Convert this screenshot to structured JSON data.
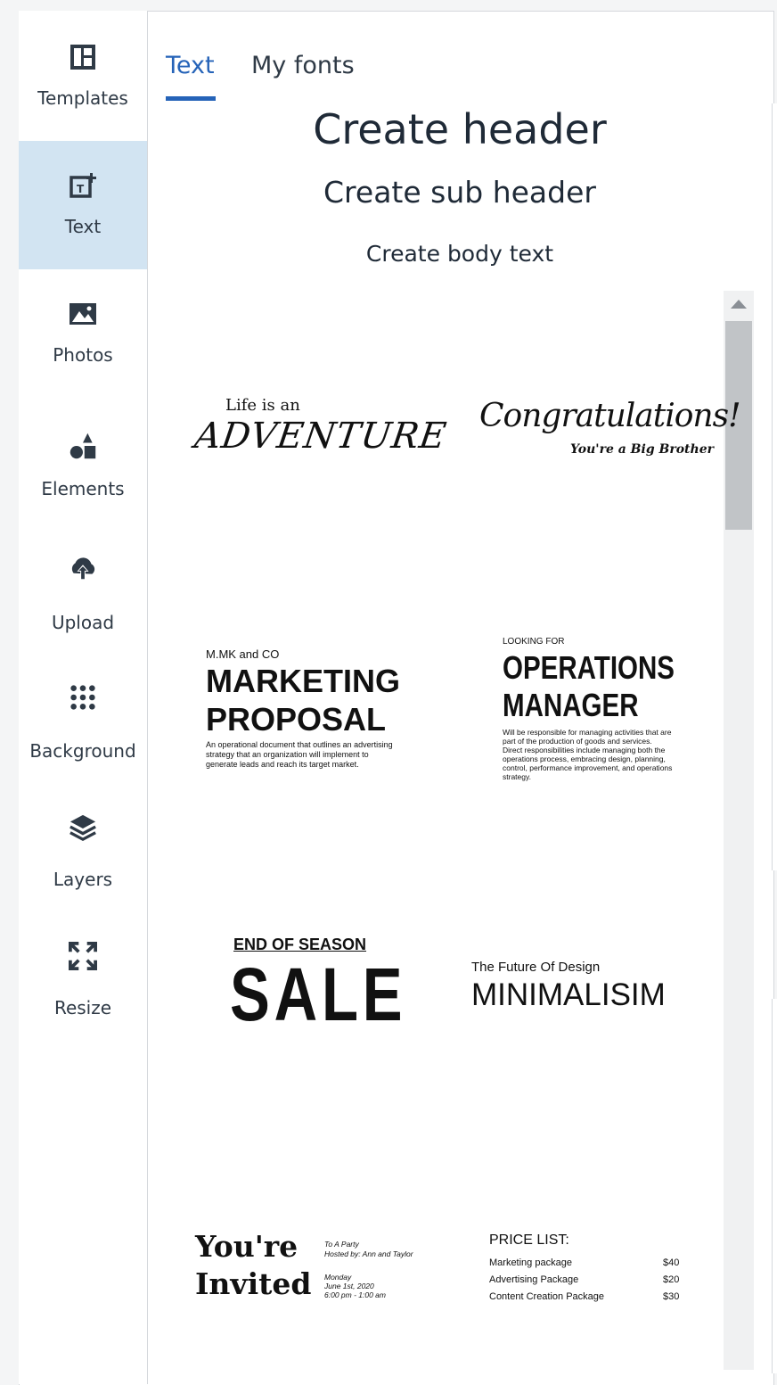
{
  "sidebar": {
    "items": [
      {
        "label": "Templates",
        "icon": "templates-icon"
      },
      {
        "label": "Text",
        "icon": "text-icon",
        "active": true
      },
      {
        "label": "Photos",
        "icon": "photos-icon"
      },
      {
        "label": "Elements",
        "icon": "elements-icon"
      },
      {
        "label": "Upload",
        "icon": "upload-icon"
      },
      {
        "label": "Background",
        "icon": "background-icon"
      },
      {
        "label": "Layers",
        "icon": "layers-icon"
      },
      {
        "label": "Resize",
        "icon": "resize-icon"
      }
    ]
  },
  "tabs": [
    {
      "label": "Text",
      "active": true
    },
    {
      "label": "My fonts",
      "active": false
    }
  ],
  "create": {
    "header": "Create header",
    "subheader": "Create sub header",
    "body": "Create body text"
  },
  "templates": {
    "adventure": {
      "line1": "Life is an",
      "line2": "ADVENTURE"
    },
    "congrats": {
      "line1": "Congratulations!",
      "line2": "You're a Big Brother"
    },
    "marketing": {
      "line1": "M.MK and CO",
      "line2": "MARKETING",
      "line3": "PROPOSAL",
      "body1": "An operational document that outlines an advertising",
      "body2": "strategy that an organization will implement to",
      "body3": "generate leads and reach its target market."
    },
    "operations": {
      "line1": "LOOKING FOR",
      "line2": "OPERATIONS",
      "line3": "MANAGER",
      "body1": "Will be responsible for managing activities that are",
      "body2": "part of the production of goods and services.",
      "body3": "Direct responsibilities include managing both the",
      "body4": "operations process, embracing design, planning,",
      "body5": "control, performance improvement, and operations",
      "body6": "strategy."
    },
    "sale": {
      "line1": "END OF SEASON",
      "line2": "SALE"
    },
    "minimal": {
      "line1": "The Future Of Design",
      "line2": "MINIMALISIM"
    },
    "invited": {
      "line1": "You're",
      "line2": "Invited",
      "d1": "To A Party",
      "d2": "Hosted by: Ann and Taylor",
      "d3": "Monday",
      "d4": "June 1st, 2020",
      "d5": "6:00 pm - 1:00 am"
    },
    "pricelist": {
      "title": "PRICE LIST:",
      "rows": [
        {
          "name": "Marketing package",
          "price": "$40"
        },
        {
          "name": "Advertising Package",
          "price": "$20"
        },
        {
          "name": "Content Creation Package",
          "price": "$30"
        }
      ]
    }
  },
  "colors": {
    "accent": "#2563b8",
    "active_bg": "#d2e4f2"
  }
}
